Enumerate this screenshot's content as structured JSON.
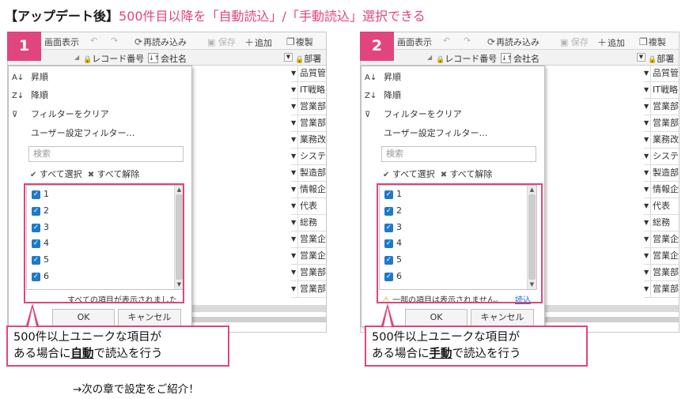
{
  "headline": {
    "prefix": "【アップデート後】",
    "main": "500件目以降を「自動読込」/「手動読込」選択できる"
  },
  "colors": {
    "accent": "#e0457e",
    "checkbox": "#1f78c8",
    "link": "#1f6fc4"
  },
  "toolbar": {
    "view_label": "画面表示",
    "undo_icon": "undo-icon",
    "redo_icon": "redo-icon",
    "reload_label": "再読み込み",
    "save_label": "保存",
    "add_label": "追加",
    "copy_label": "複製"
  },
  "columns": {
    "record_no": "レコード番号",
    "company": "会社名",
    "dept": "部署"
  },
  "dept_cells": [
    "品質管",
    "IT戦略",
    "営業部",
    "営業部",
    "業務改",
    "システ",
    "製造部",
    "情報企",
    "代表",
    "総務",
    "営業企",
    "営業企",
    "営業部",
    "営業部"
  ],
  "filter_menu": {
    "sort_asc": "昇順",
    "sort_desc": "降順",
    "clear_filter": "フィルターをクリア",
    "user_filter": "ユーザー設定フィルター…",
    "search_placeholder": "検索",
    "select_all": "すべて選択",
    "deselect_all": "すべて解除",
    "items": [
      "1",
      "2",
      "3",
      "4",
      "5",
      "6"
    ],
    "ok_label": "OK",
    "cancel_label": "キャンセル"
  },
  "panels": [
    {
      "badge": "1",
      "status_text": "すべての項目が表示されました",
      "callout_line1": "500件以上ユニークな項目が",
      "callout_line2_pre": "ある場合に",
      "callout_emph": "自動",
      "callout_line2_post": "で読込を行う"
    },
    {
      "badge": "2",
      "status_text": "一部の項目は表示されません。",
      "status_link": "読込",
      "callout_line1": "500件以上ユニークな項目が",
      "callout_line2_pre": "ある場合に",
      "callout_emph": "手動",
      "callout_line2_post": "で読込を行う"
    }
  ],
  "footer_note": "→次の章で設定をご紹介！"
}
